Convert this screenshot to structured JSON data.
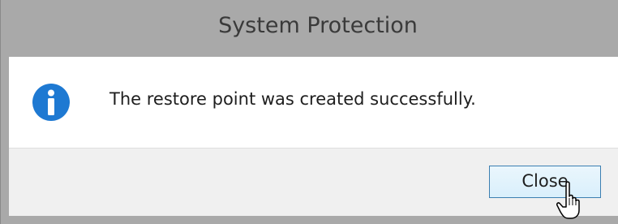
{
  "window": {
    "title": "System Protection"
  },
  "dialog": {
    "icon": "info-icon",
    "message": "The restore point was created successfully."
  },
  "footer": {
    "close_label": "Close"
  },
  "colors": {
    "titlebar": "#a9a9a9",
    "info_blue": "#1e79d2",
    "button_border": "#3c7fb1"
  }
}
